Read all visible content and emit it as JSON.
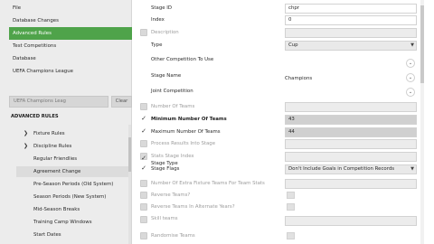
{
  "top_menu": {
    "items": [
      "File",
      "Database Changes",
      "Advanced Rules",
      "Test Competitions",
      "Database",
      "UEFA Champions League"
    ],
    "active_item": "Advanced Rules"
  },
  "filter": {
    "value": "UEFA Champions Leag",
    "clear_label": "Clear"
  },
  "advanced_rules": {
    "heading": "ADVANCED RULES",
    "items": [
      {
        "label": "Fixture Rules",
        "expandable": true
      },
      {
        "label": "Discipline Rules",
        "expandable": true
      },
      {
        "label": "Regular Friendlies",
        "expandable": false
      },
      {
        "label": "Agreement Change",
        "expandable": false
      },
      {
        "label": "Pre-Season Periods (Old System)",
        "expandable": false
      },
      {
        "label": "Season Periods (New System)",
        "expandable": false
      },
      {
        "label": "Mid-Season Breaks",
        "expandable": false
      },
      {
        "label": "Training Camp Windows",
        "expandable": false
      },
      {
        "label": "Start Dates",
        "expandable": false
      }
    ],
    "highlighted_item": "Agreement Change"
  },
  "details": {
    "stage_id_label": "Stage ID",
    "stage_id_value": "chpr",
    "index_label": "Index",
    "index_value": "0",
    "description_label": "Description",
    "type_label": "Type",
    "type_value": "Cup",
    "other_competition_label": "Other Competition To Use",
    "stage_name_label": "Stage Name",
    "stage_name_value": "Champions",
    "joint_competition_label": "Joint Competition",
    "number_of_teams_label": "Number Of Teams",
    "min_teams_label": "Minimum Number Of Teams",
    "min_teams_value": "43",
    "max_teams_label": "Maximum Number Of Teams",
    "max_teams_value": "44",
    "process_results_label": "Process Results Into Stage",
    "stats_stage_label": "Stats Stage Index",
    "stage_type_label": "Stage Type",
    "stage_flags_label": "Stage Flags",
    "stage_flags_value": "Don't Include Goals in Competition Records",
    "extra_fixture_label": "Number Of Extra Fixture Teams For Team Stats",
    "reverse_teams_label": "Reverse Teams?",
    "reverse_alternate_label": "Reverse Teams In Alternate Years?",
    "skill_teams_label": "Skill teams",
    "randomise_label": "Randomise Teams"
  },
  "icon_names": [
    "chevron-right-icon",
    "checkmark-icon",
    "chevron-down-icon"
  ],
  "colors": {
    "accent": "#4fa34a",
    "panel_bg": "#ececec",
    "field_dark": "#d0d0d0"
  }
}
